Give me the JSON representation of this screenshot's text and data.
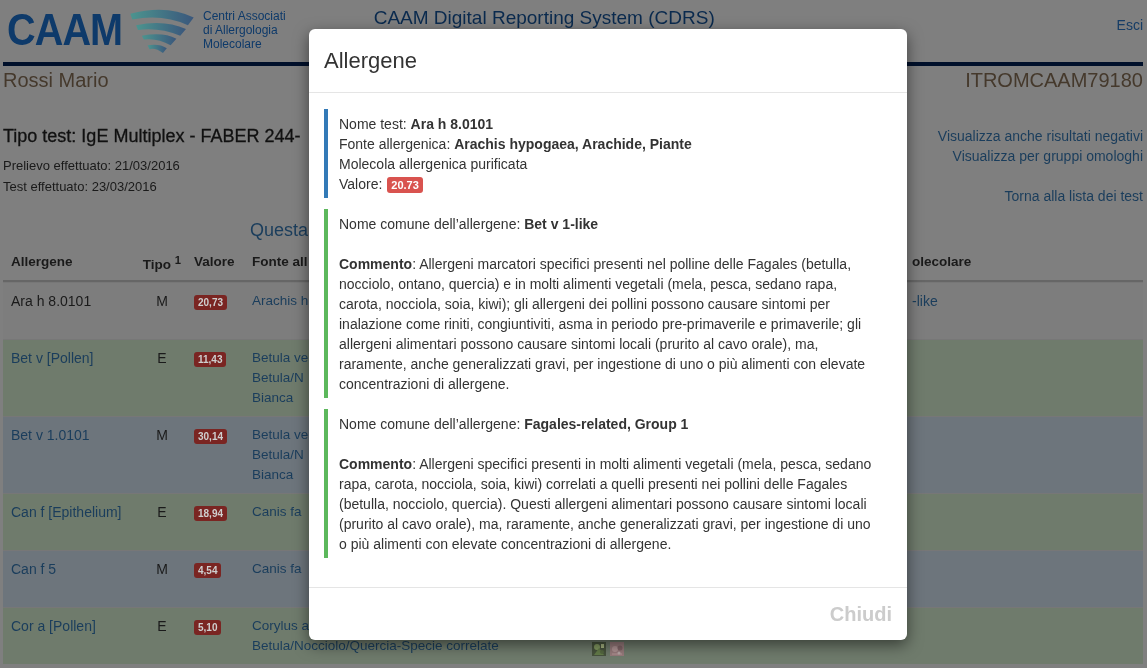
{
  "header": {
    "logo": {
      "brand": "CAAM",
      "tagline": [
        "Centri Associati",
        "di Allergologia",
        "Molecolare"
      ]
    },
    "app_title": "CAAM Digital Reporting System (CDRS)",
    "logout": "Esci"
  },
  "patient": {
    "name": "Rossi Mario",
    "code": "ITROMCAAM79180"
  },
  "test_info": {
    "title": "Tipo test: IgE Multiplex - FABER 244-",
    "dates": [
      "Prelievo effettuato: 21/03/2016",
      "Test effettuato: 23/03/2016"
    ]
  },
  "links": [
    "Visualizza anche risultati negativi",
    "Visualizza per gruppi omologhi",
    "Torna alla lista dei test"
  ],
  "table": {
    "heading": "Questa",
    "columns": [
      "Allergene",
      "Tipo $^{1}$",
      "Valore",
      "Fonte all",
      "olecolare"
    ],
    "rows": [
      {
        "allergen": "Ara h 8.0101",
        "type": "M",
        "value": "20,73",
        "source": [
          "Arachis h"
        ],
        "last": "-like",
        "selected": true
      },
      {
        "allergen": "Bet v [Pollen]",
        "type": "E",
        "value": "11,43",
        "source": [
          "Betula ve",
          "Betula/N",
          "Bianca"
        ],
        "selected": false,
        "color": "#6f7b6c"
      },
      {
        "allergen": "Bet v 1.0101",
        "type": "M",
        "value": "30,14",
        "source": [
          "Betula ve",
          "Betula/N",
          "Bianca"
        ],
        "selected": false,
        "color": "#6d757c"
      },
      {
        "allergen": "Can f [Epithelium]",
        "type": "E",
        "value": "18,94",
        "source": [
          "Canis fa"
        ],
        "selected": false,
        "color": "#6f7b6c"
      },
      {
        "allergen": "Can f 5",
        "type": "M",
        "value": "4,54",
        "source": [
          "Canis fa"
        ],
        "selected": false,
        "color": "#6d757c"
      },
      {
        "allergen": "Cor a [Pollen]",
        "type": "E",
        "value": "5,10",
        "source": [
          "Corylus a",
          "Betula/Nocciolo/Quercia-Specie correlate"
        ],
        "images": [
          {
            "kind": "picture"
          },
          {
            "kind": "picture"
          }
        ],
        "selected": false,
        "color": "#6f7b6c"
      }
    ]
  },
  "modal": {
    "title": "Allergene",
    "blocks": [
      {
        "kind": "info",
        "color": "#337ab7",
        "lines": [
          "Nome test: **Ara h 8.0101**",
          "Fonte allergenica: **Arachis hypogaea, Arachide, Piante**",
          "Molecola allergenica purificata"
        ],
        "value_label": "Valore:",
        "value": "20.73"
      },
      {
        "kind": "comment",
        "color": "#5cb85c",
        "name": "Nome comune dell’allergene: **Bet v 1-like**",
        "comment": "**Commento**: Allergeni marcatori specifici presenti nel polline delle Fagales (betulla, nocciolo, ontano, quercia) e in molti alimenti vegetali (mela, pesca, sedano rapa, carota, nocciola, soia, kiwi); gli allergeni dei pollini possono causare sintomi per inalazione come riniti, congiuntiviti, asma in periodo pre-primaverile e primaverile; gli allergeni alimentari possono causare sintomi locali (prurito al cavo orale), ma, raramente, anche generalizzati gravi, per ingestione di uno o più alimenti con elevate concentrazioni di allergene."
      },
      {
        "kind": "comment",
        "color": "#5cb85c",
        "name": "Nome comune dell’allergene: **Fagales-related, Group 1**",
        "comment": "**Commento**: Allergeni specifici presenti in molti alimenti vegetali (mela, pesca, sedano rapa, carota, nocciola, soia, kiwi) correlati a quelli presenti nei pollini delle Fagales (betulla, nocciolo, quercia). Questi allergeni alimentari possono causare sintomi locali (prurito al cavo orale), ma, raramente, anche generalizzati gravi, per ingestione di uno o più alimenti con elevate concentrazioni di allergene."
      }
    ],
    "close": "Chiudi"
  }
}
